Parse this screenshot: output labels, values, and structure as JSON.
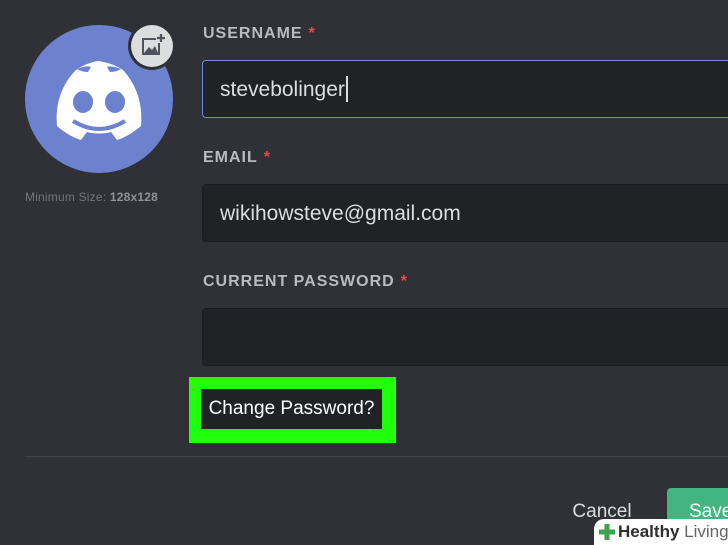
{
  "profile": {
    "min_size_label": "Minimum Size:",
    "min_size_value": "128x128",
    "avatar_icon": "discord-logo-icon",
    "upload_icon": "add-image-icon"
  },
  "fields": {
    "username": {
      "label": "USERNAME",
      "required": "*",
      "value": "stevebolinger"
    },
    "email": {
      "label": "EMAIL",
      "required": "*",
      "value": "wikihowsteve@gmail.com"
    },
    "password": {
      "label": "CURRENT PASSWORD",
      "required": "*",
      "value": ""
    }
  },
  "actions": {
    "change_password": "Change Password?",
    "cancel": "Cancel",
    "save": "Save"
  },
  "watermark": {
    "word1": "Healthy",
    "word2": "Living"
  },
  "colors": {
    "background": "#2f3136",
    "input": "#202225",
    "avatar": "#6c82cf",
    "focus": "#7289da",
    "required": "#f04747",
    "save": "#43b581",
    "highlight": "#22ff0c"
  }
}
